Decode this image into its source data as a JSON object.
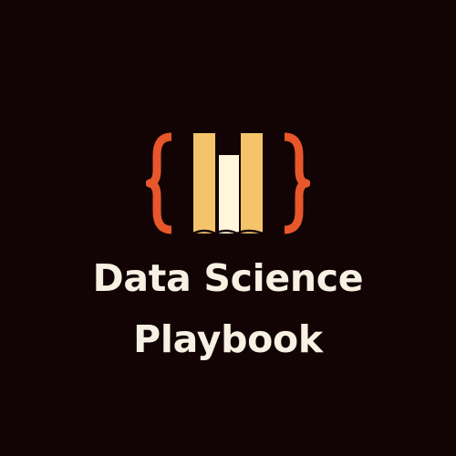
{
  "brand": {
    "line1": "Data Science",
    "line2": "Playbook"
  },
  "logo": {
    "icon": "code-braces-book-icon",
    "brace_color": "#E8562B",
    "outer_book_color": "#F5C36A",
    "middle_book_color": "#FFF6DB",
    "book_spine_stroke": "#120405"
  },
  "colors": {
    "background": "#120405",
    "text": "#F7F1E3"
  }
}
